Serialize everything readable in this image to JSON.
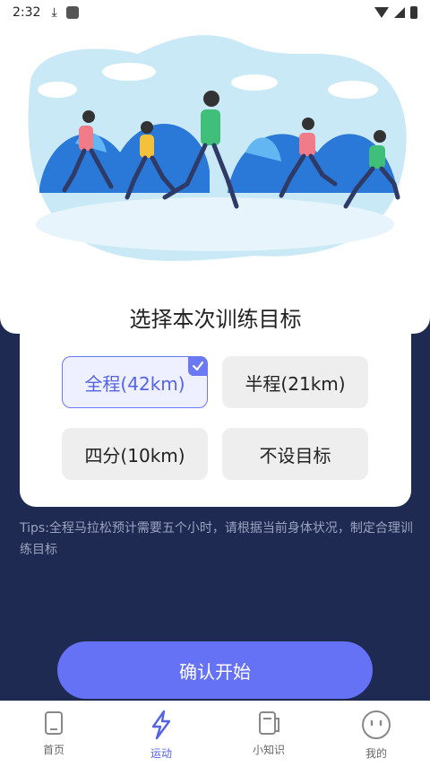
{
  "status_bar": {
    "time": "2:32"
  },
  "card": {
    "title": "选择本次训练目标",
    "options": [
      {
        "label": "全程(42km)",
        "selected": true
      },
      {
        "label": "半程(21km)",
        "selected": false
      },
      {
        "label": "四分(10km)",
        "selected": false
      },
      {
        "label": "不设目标",
        "selected": false
      }
    ]
  },
  "tips": "Tips:全程马拉松预计需要五个小时，请根据当前身体状况，制定合理训练目标",
  "confirm_label": "确认开始",
  "nav": [
    {
      "label": "首页",
      "icon": "home-phone-icon",
      "active": false
    },
    {
      "label": "运动",
      "icon": "lightning-icon",
      "active": true
    },
    {
      "label": "小知识",
      "icon": "notebook-icon",
      "active": false
    },
    {
      "label": "我的",
      "icon": "smiley-icon",
      "active": false
    }
  ],
  "colors": {
    "accent": "#6672f5",
    "background": "#1e2a52",
    "selected_bg": "#eef0ff"
  }
}
